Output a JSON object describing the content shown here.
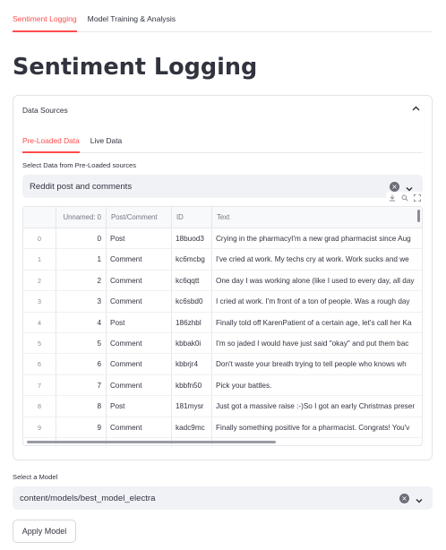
{
  "top_tabs": [
    "Sentiment Logging",
    "Model Training & Analysis"
  ],
  "page_title": "Sentiment Logging",
  "expander": {
    "title": "Data Sources",
    "expanded": true
  },
  "inner_tabs": [
    "Pre-Loaded Data",
    "Live Data"
  ],
  "data_select": {
    "label": "Select Data from Pre-Loaded sources",
    "value": "Reddit post and comments"
  },
  "table": {
    "columns": [
      "Unnamed: 0",
      "Post/Comment",
      "ID",
      "Text"
    ],
    "rows": [
      {
        "index": "0",
        "unnamed": "0",
        "type": "Post",
        "id": "18buod3",
        "text": "Crying in the pharmacyI'm a new grad pharmacist since Aug"
      },
      {
        "index": "1",
        "unnamed": "1",
        "type": "Comment",
        "id": "kc6mcbg",
        "text": "I've cried at work. My techs cry at work. Work sucks and we"
      },
      {
        "index": "2",
        "unnamed": "2",
        "type": "Comment",
        "id": "kc6qqtt",
        "text": "One day I was working alone (like I used to every day, all day"
      },
      {
        "index": "3",
        "unnamed": "3",
        "type": "Comment",
        "id": "kc6sbd0",
        "text": "I cried at work. I'm front of a ton of people. Was a rough day"
      },
      {
        "index": "4",
        "unnamed": "4",
        "type": "Post",
        "id": "186zhbl",
        "text": "Finally told off KarenPatient of a certain age, let's call her Ka"
      },
      {
        "index": "5",
        "unnamed": "5",
        "type": "Comment",
        "id": "kbbak0i",
        "text": "I'm so jaded I would have just said \"okay\" and put them bac"
      },
      {
        "index": "6",
        "unnamed": "6",
        "type": "Comment",
        "id": "kbbrjr4",
        "text": "Don't waste your breath trying to tell people who knows wh"
      },
      {
        "index": "7",
        "unnamed": "7",
        "type": "Comment",
        "id": "kbbfn50",
        "text": "Pick your battles."
      },
      {
        "index": "8",
        "unnamed": "8",
        "type": "Post",
        "id": "181mysr",
        "text": "Just got a massive raise :-)So I got an early Christmas preser"
      },
      {
        "index": "9",
        "unnamed": "9",
        "type": "Comment",
        "id": "kadc9mc",
        "text": "Finally something positive for a pharmacist. Congrats! You'v"
      }
    ]
  },
  "model_select": {
    "label": "Select a Model",
    "value": "content/models/best_model_electra"
  },
  "apply_button": "Apply Model",
  "icons": [
    "clear-icon",
    "chevron-down-icon",
    "chevron-up-icon",
    "download-icon",
    "search-icon",
    "fullscreen-icon"
  ],
  "colors": {
    "accent": "#ff4b4b",
    "text": "#31333f",
    "input_bg": "#f0f2f6"
  }
}
